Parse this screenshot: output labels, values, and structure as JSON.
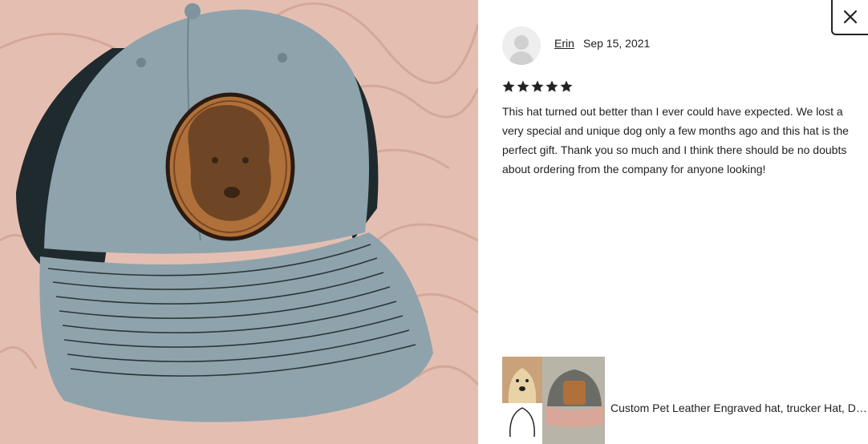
{
  "photo": {
    "alt_icon": "hat-photo"
  },
  "close": {
    "icon": "close-icon"
  },
  "review": {
    "reviewer_name": "Erin",
    "date": "Sep 15, 2021",
    "rating": 5,
    "max_rating": 5,
    "text": "This hat turned out better than I ever could have expected. We lost a very special and unique dog only a few months ago and this hat is the perfect gift. Thank you so much and I think there should be no doubts about ordering from the company for anyone looking!"
  },
  "listing": {
    "title": "Custom Pet Leather Engraved hat, trucker Hat, Dog Hat, Pet Portrait Hat"
  },
  "colors": {
    "star": "#222222",
    "text": "#222222",
    "hat_crown": "#8fa3ac",
    "patch": "#b0703a"
  }
}
